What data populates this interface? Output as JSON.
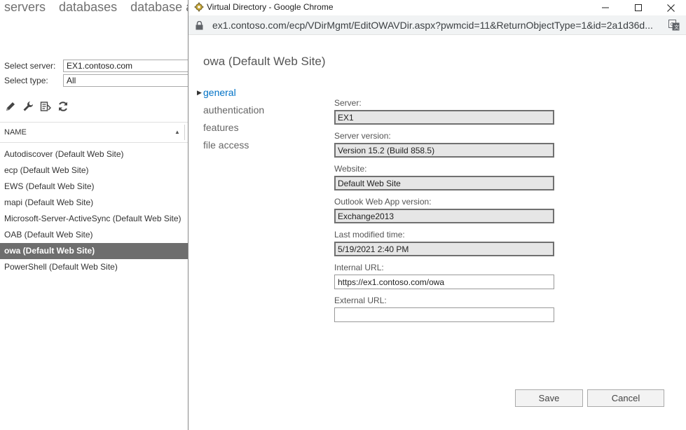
{
  "ecp": {
    "top_nav": [
      "servers",
      "databases",
      "database ava"
    ],
    "select_server_label": "Select server:",
    "select_server_value": "EX1.contoso.com",
    "select_type_label": "Select type:",
    "select_type_value": "All",
    "toolbar_icons": [
      "pencil-icon",
      "wrench-icon",
      "reset-icon",
      "refresh-icon"
    ],
    "column_name": "NAME",
    "items": [
      "Autodiscover (Default Web Site)",
      "ecp (Default Web Site)",
      "EWS (Default Web Site)",
      "mapi (Default Web Site)",
      "Microsoft-Server-ActiveSync (Default Web Site)",
      "OAB (Default Web Site)",
      "owa (Default Web Site)",
      "PowerShell (Default Web Site)"
    ],
    "selected_item": "owa (Default Web Site)"
  },
  "popup": {
    "window_title": "Virtual Directory - Google Chrome",
    "url": "ex1.contoso.com/ecp/VDirMgmt/EditOWAVDir.aspx?pwmcid=11&ReturnObjectType=1&id=2a1d36d...",
    "heading": "owa (Default Web Site)",
    "sections": [
      "general",
      "authentication",
      "features",
      "file access"
    ],
    "active_section": "general",
    "fields": {
      "server_label": "Server:",
      "server_value": "EX1",
      "version_label": "Server version:",
      "version_value": "Version 15.2 (Build 858.5)",
      "website_label": "Website:",
      "website_value": "Default Web Site",
      "owa_version_label": "Outlook Web App version:",
      "owa_version_value": "Exchange2013",
      "modified_label": "Last modified time:",
      "modified_value": "5/19/2021 2:40 PM",
      "internal_url_label": "Internal URL:",
      "internal_url_value": "https://ex1.contoso.com/owa",
      "external_url_label": "External URL:",
      "external_url_value": ""
    },
    "save_label": "Save",
    "cancel_label": "Cancel"
  },
  "colors": {
    "accent": "#0072c6",
    "selected_row": "#6e6e6e",
    "readonly_field": "#e6e6e6"
  }
}
